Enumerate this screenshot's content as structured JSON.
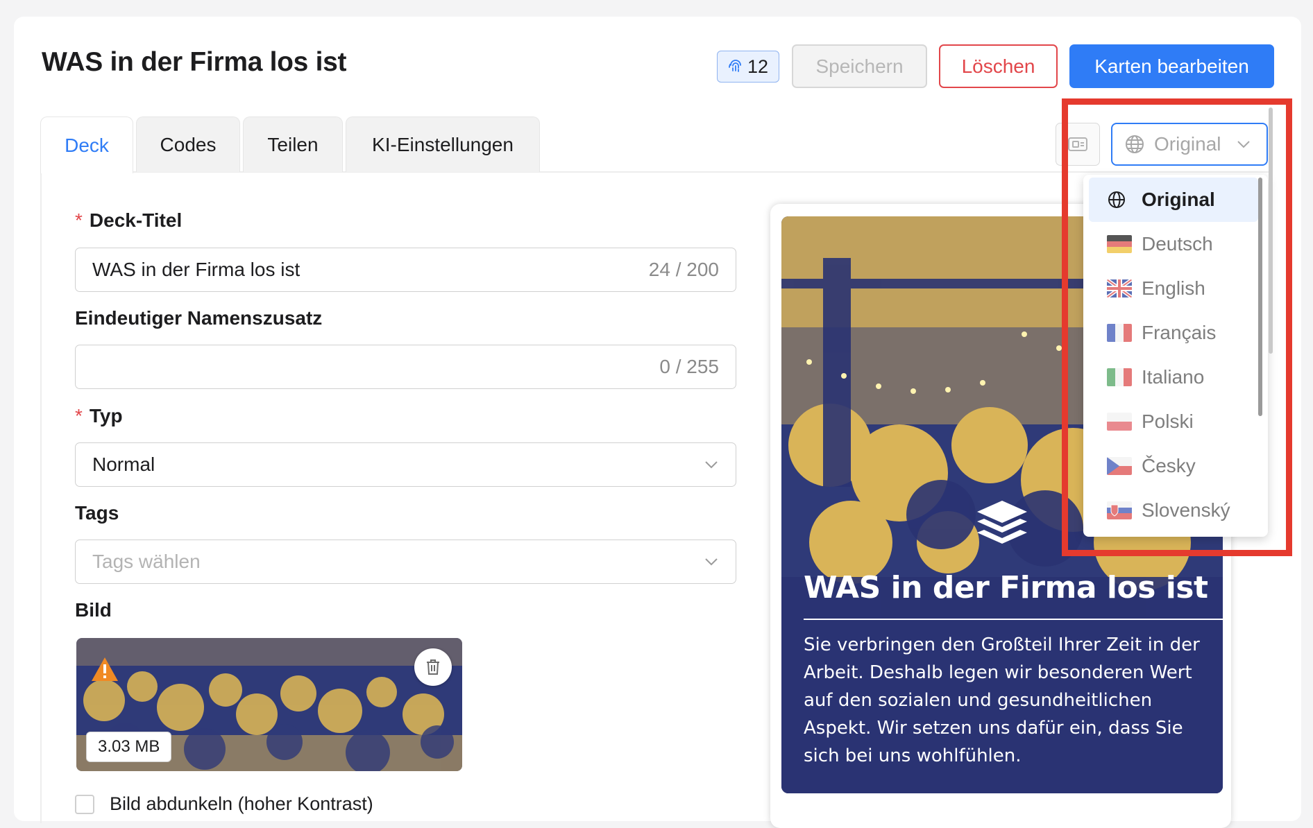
{
  "header": {
    "title": "WAS in der Firma los ist",
    "badge_count": "12",
    "save_label": "Speichern",
    "delete_label": "Löschen",
    "edit_cards_label": "Karten bearbeiten"
  },
  "tabs": [
    {
      "label": "Deck",
      "active": true
    },
    {
      "label": "Codes",
      "active": false
    },
    {
      "label": "Teilen",
      "active": false
    },
    {
      "label": "KI-Einstellungen",
      "active": false
    }
  ],
  "language_select": {
    "value": "Original",
    "options": [
      {
        "label": "Original",
        "icon": "globe-icon",
        "selected": true
      },
      {
        "label": "Deutsch",
        "icon": "flag-de-icon"
      },
      {
        "label": "English",
        "icon": "flag-gb-icon"
      },
      {
        "label": "Français",
        "icon": "flag-fr-icon"
      },
      {
        "label": "Italiano",
        "icon": "flag-it-icon"
      },
      {
        "label": "Polski",
        "icon": "flag-pl-icon"
      },
      {
        "label": "Česky",
        "icon": "flag-cz-icon"
      },
      {
        "label": "Slovenský",
        "icon": "flag-sk-icon"
      }
    ]
  },
  "form": {
    "title_label": "Deck-Titel",
    "title_value": "WAS in der Firma los ist",
    "title_counter": "24 / 200",
    "suffix_label": "Eindeutiger Namenszusatz",
    "suffix_value": "",
    "suffix_counter": "0 / 255",
    "type_label": "Typ",
    "type_value": "Normal",
    "tags_label": "Tags",
    "tags_placeholder": "Tags wählen",
    "image_label": "Bild",
    "image_size": "3.03 MB",
    "darken_label": "Bild abdunkeln (hoher Kontrast)"
  },
  "preview": {
    "title": "WAS in der Firma los ist",
    "description": "Sie verbringen den Großteil Ihrer Zeit in der Arbeit. Deshalb legen wir besonderen Wert auf den sozialen und gesundheitli­chen Aspekt. Wir setzen uns dafür ein, dass Sie sich bei uns wohlfühlen."
  },
  "colors": {
    "accent": "#2f7cf6",
    "danger": "#e2464a",
    "highlight": "#e53a2e",
    "preview_navy": "#2a3372",
    "preview_gold": "#d9b458"
  }
}
